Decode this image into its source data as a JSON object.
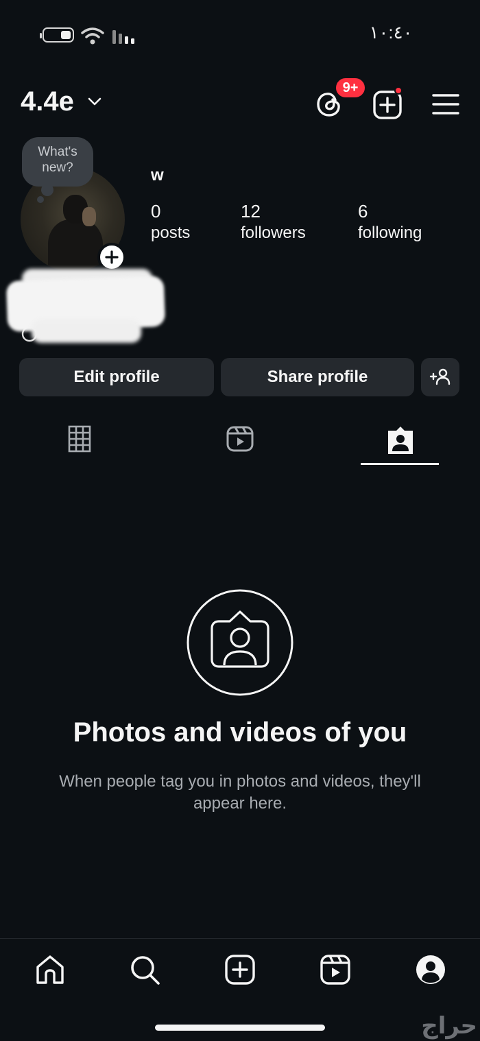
{
  "status_bar": {
    "time": "١٠:٤٠",
    "battery_icon": "battery-icon",
    "wifi_icon": "wifi-icon",
    "signal_icon": "cellular-signal-icon"
  },
  "header": {
    "username": "4.4e",
    "threads_badge": "9+",
    "icons": [
      "chevron-down-icon",
      "threads-icon",
      "create-plus-icon",
      "menu-icon"
    ]
  },
  "profile": {
    "note_text": "What's new?",
    "display_name": "w",
    "stats": [
      {
        "value": "0",
        "label": "posts"
      },
      {
        "value": "12",
        "label": "followers"
      },
      {
        "value": "6",
        "label": "following"
      }
    ]
  },
  "actions": {
    "edit_profile": "Edit profile",
    "share_profile": "Share profile",
    "discover_icon": "add-person-icon"
  },
  "tabs": [
    {
      "name": "grid",
      "icon": "grid-icon",
      "active": false
    },
    {
      "name": "reels",
      "icon": "reels-icon",
      "active": false
    },
    {
      "name": "tagged",
      "icon": "tagged-person-icon",
      "active": true
    }
  ],
  "empty_state": {
    "title": "Photos and videos of you",
    "description": "When people tag you in photos and videos, they'll appear here."
  },
  "bottom_nav": [
    {
      "name": "home",
      "icon": "home-icon"
    },
    {
      "name": "search",
      "icon": "search-icon"
    },
    {
      "name": "create",
      "icon": "create-icon"
    },
    {
      "name": "reels",
      "icon": "reels-icon"
    },
    {
      "name": "profile",
      "icon": "profile-icon"
    }
  ],
  "watermark": "حراج",
  "colors": {
    "background": "#0c1014",
    "button_bg": "#25292e",
    "badge_red": "#ff3040",
    "text_primary": "#f5f5f5",
    "text_secondary": "#a8acb1"
  }
}
